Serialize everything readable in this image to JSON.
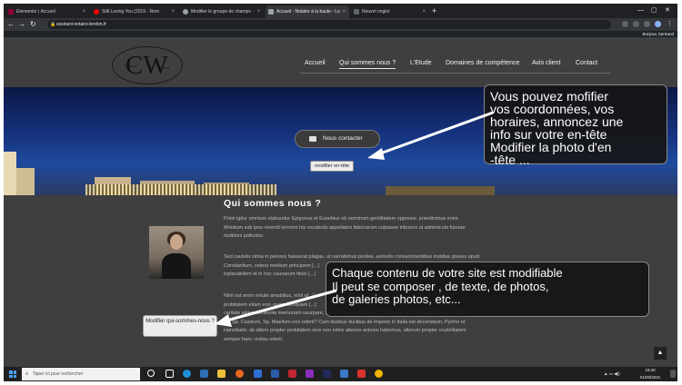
{
  "browser": {
    "tabs": [
      {
        "label": "Elementor | Accueil",
        "active": false
      },
      {
        "label": "Still Loving You (2015 - Rem",
        "active": false
      },
      {
        "label": "Modifier le groupe de champs ·",
        "active": false
      },
      {
        "label": "Accueil - Notaire à la baule - Lo",
        "active": true
      },
      {
        "label": "Nouvel onglet",
        "active": false
      }
    ],
    "new_tab": "+",
    "url": "essirard-notaire-breton.fr",
    "minimize": "—",
    "maximize": "▢",
    "close": "✕"
  },
  "adminbar": {
    "greeting": "Bonjour, bertrand"
  },
  "site": {
    "logo": {
      "letters": "CW",
      "small_left": "Desirée",
      "small_right": "Esq"
    },
    "menu": [
      "Accueil",
      "Qui sommes nous ?",
      "L'Etude",
      "Domaines de compétence",
      "Avis client",
      "Contact"
    ],
    "hero": {
      "contact_label": "Nous contacter",
      "edit_header_label": "modifier en-tête"
    },
    "section_title": "Qui sommes nous ?",
    "paragraphs": [
      [
        "Primi igitur omnium statuuntur Epigonus et Eusebius ob nominum gentilitatem oppressi. praediximus enim",
        "Montium sub ipso vivendi termino his vocabulis appellatos fabricarum culpasse tribunos ut adminicula futurae",
        "molitioni pollicitos."
      ],
      [
        "Sed cautela nimia in peiores haeserat plagas, ut narrabimus postea, aemulis consarcinantibus insidias graves apud",
        "Constantium, cetera medium principem [...]",
        "inplacabilem et in hoc causarum titulo [...]"
      ],
      [
        "Nihil est enim virtute amabilius, nihil q[...]",
        "probitatem etiam eos, quos numquam [...]",
        "caritate aliqua benevola memoriam usurpare, quos numquam vidimus? Quis autem, ceteris paribus, non diligit,",
        "qui Sp. Cassium, Sp. Maelium non oderit? Cum duobus ducibus de imperio in Italia est decertatum, Pyrrho et",
        "Hannibale; ab altero propter probitatem eius non nimis alienos animos habemus, alterum propter crudelitatem",
        "semper haec civitas oderit."
      ]
    ],
    "edit_who_label": "Modifier qui-sommes-nous ?",
    "scroll_top": "▲"
  },
  "callouts": {
    "header": [
      "Vous pouvez mofifier",
      "vos coordonnées, vos",
      "horaires, annoncez une",
      "info sur votre en-tête",
      "Modifier la photo d'en",
      "-tête ..."
    ],
    "content": [
      "Chaque contenu de votre site est modifiable",
      "Il peut se composer , de texte, de photos,",
      "de galeries photos, etc..."
    ]
  },
  "taskbar": {
    "search_placeholder": "Taper ici pour rechercher",
    "time": "15:40",
    "date": "01/03/2021"
  },
  "colors": {
    "header_bg": "#3f3f3f",
    "content_bg": "#3f3f3f",
    "hero_sky": "#15307a",
    "callout_bg": "#161616",
    "arrow": "#ffffff"
  }
}
